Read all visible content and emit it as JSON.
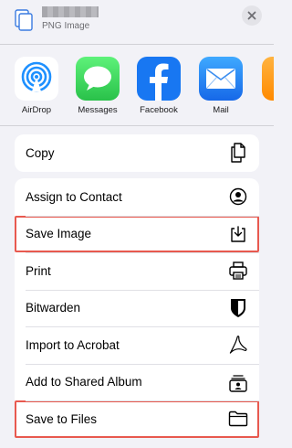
{
  "header": {
    "file_type": "PNG Image"
  },
  "apps": [
    {
      "label": "AirDrop",
      "icon": "airdrop-icon",
      "color": "#ffffff"
    },
    {
      "label": "Messages",
      "icon": "messages-icon",
      "color": "#34c759"
    },
    {
      "label": "Facebook",
      "icon": "facebook-icon",
      "color": "#1877f2"
    },
    {
      "label": "Mail",
      "icon": "mail-icon",
      "color": "#1a8cff"
    }
  ],
  "actions_group1": [
    {
      "label": "Copy",
      "icon": "copy-icon"
    }
  ],
  "actions_group2": [
    {
      "label": "Assign to Contact",
      "icon": "contact-icon",
      "highlighted": false
    },
    {
      "label": "Save Image",
      "icon": "save-image-icon",
      "highlighted": true
    },
    {
      "label": "Print",
      "icon": "printer-icon",
      "highlighted": false
    },
    {
      "label": "Bitwarden",
      "icon": "bitwarden-shield-icon",
      "highlighted": false
    },
    {
      "label": "Import to Acrobat",
      "icon": "acrobat-icon",
      "highlighted": false
    },
    {
      "label": "Add to Shared Album",
      "icon": "shared-album-icon",
      "highlighted": false
    },
    {
      "label": "Save to Files",
      "icon": "folder-icon",
      "highlighted": true
    }
  ],
  "colors": {
    "highlight_border": "#e8594f",
    "background": "#f2f2f7"
  }
}
